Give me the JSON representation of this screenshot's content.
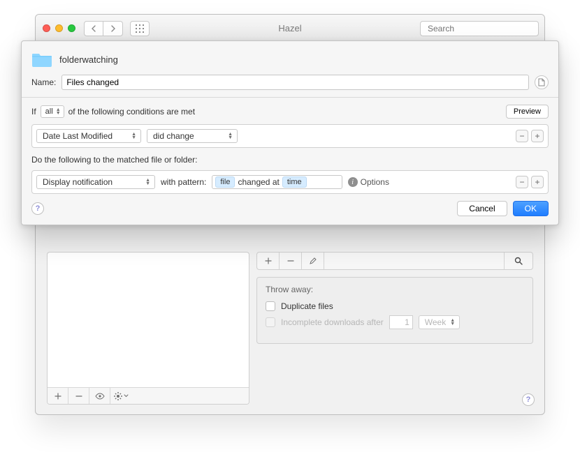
{
  "parent_window": {
    "title": "Hazel",
    "search_placeholder": "Search",
    "throwaway": {
      "heading": "Throw away:",
      "duplicate_label": "Duplicate files",
      "incomplete_label": "Incomplete downloads after",
      "incomplete_value": "1",
      "incomplete_unit": "Week"
    }
  },
  "sheet": {
    "folder_name": "folderwatching",
    "name_label": "Name:",
    "name_value": "Files changed",
    "if_label": "If",
    "if_scope": "all",
    "if_suffix": "of the following conditions are met",
    "preview_label": "Preview",
    "condition": {
      "attribute": "Date Last Modified",
      "comparator": "did change"
    },
    "do_label": "Do the following to the matched file or folder:",
    "action": {
      "name": "Display notification",
      "with_pattern_label": "with pattern:",
      "token_file": "file",
      "literal": "changed at",
      "token_time": "time",
      "options_label": "Options"
    },
    "buttons": {
      "cancel": "Cancel",
      "ok": "OK"
    }
  }
}
